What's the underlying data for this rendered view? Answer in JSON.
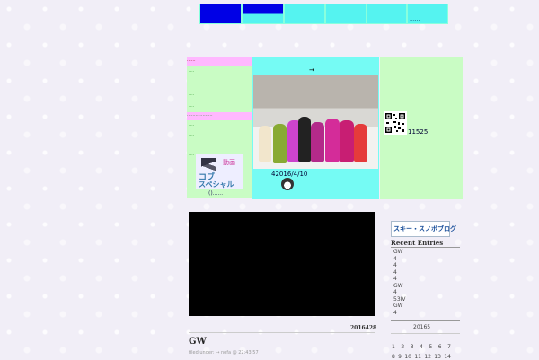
{
  "nav": {
    "item_label": "......"
  },
  "left_sidebar": {
    "section1_head": "......",
    "section1_links": [
      "....",
      "....",
      "....",
      "...."
    ],
    "section2_head": "..................",
    "section2_links": [
      "....",
      "....",
      "....",
      "....",
      "...."
    ],
    "banner_title": "動画",
    "banner_line1": "コブ",
    "banner_line2": "スペシャル",
    "banner_caption": "()......"
  },
  "center": {
    "header_text": "→",
    "photo_caption": "42016/4/10"
  },
  "right_panel": {
    "qr_count": "11525"
  },
  "post": {
    "date": "2016428",
    "title": "GW",
    "meta": "filed under: → nofa @ 22:43:57"
  },
  "sidebar_right": {
    "logo_text": "スキー・スノボブログ",
    "recent_title": "Recent Entries",
    "recent_entries": [
      "GW",
      "4",
      "4",
      "4",
      "4",
      "GW",
      "4",
      "53IV",
      "GW",
      "4"
    ],
    "calendar_title": "20165",
    "calendar_days": [
      "1",
      "2",
      "3",
      "4",
      "5",
      "6",
      "7"
    ],
    "calendar_days2": [
      "8",
      "9",
      "10",
      "11",
      "12",
      "13",
      "14"
    ]
  },
  "colors": {
    "nav_blue": "#0000e6",
    "nav_cyan": "#55f3f0",
    "panel_green": "#c9fcc4",
    "panel_pink": "#ffb8ff",
    "panel_cyan": "#75fbf4"
  }
}
